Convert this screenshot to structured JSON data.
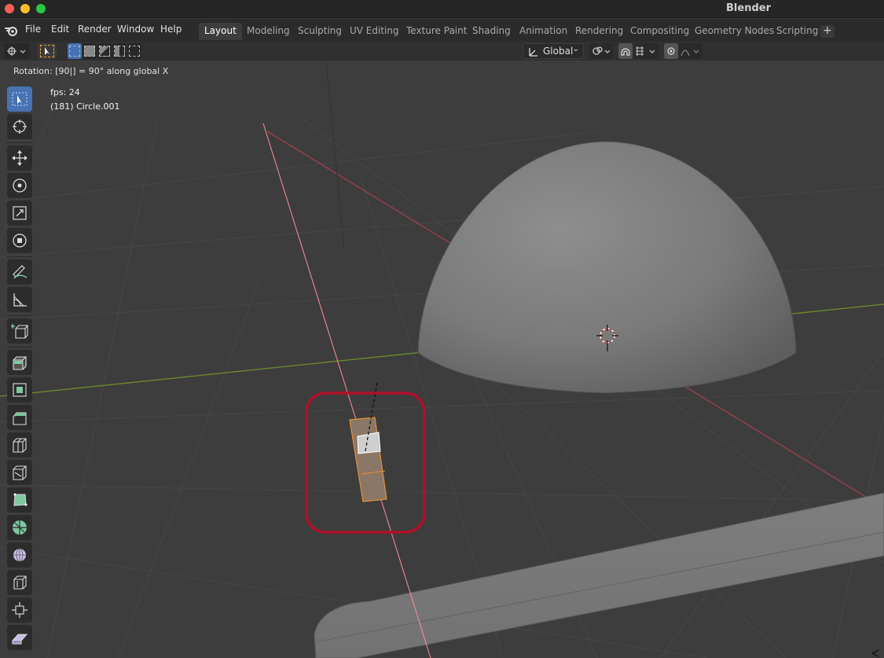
{
  "window": {
    "title": "Blender"
  },
  "menu": {
    "items": [
      "File",
      "Edit",
      "Render",
      "Window",
      "Help"
    ]
  },
  "workspaces": {
    "tabs": [
      "Layout",
      "Modeling",
      "Sculpting",
      "UV Editing",
      "Texture Paint",
      "Shading",
      "Animation",
      "Rendering",
      "Compositing",
      "Geometry Nodes",
      "Scripting"
    ],
    "active": "Layout"
  },
  "header": {
    "orientation": "Global"
  },
  "viewport": {
    "operator_text": "Rotation: [90|] = 90°  along global X",
    "fps": "fps: 24",
    "object_info": "(181) Circle.001"
  },
  "tools": [
    "select-box",
    "cursor",
    "move",
    "rotate",
    "scale",
    "transform",
    "annotate",
    "measure",
    "add-cube",
    "extrude-region",
    "inset-faces",
    "bevel",
    "loop-cut",
    "knife",
    "poly-build",
    "spin",
    "smooth",
    "edge-slide",
    "shrink-fatten",
    "shear"
  ],
  "colors": {
    "accent": "#4772b3",
    "x_axis": "#c64652",
    "y_axis": "#7a9a30",
    "selection_outline": "#e8903a",
    "highlight_box": "#b0102a"
  }
}
